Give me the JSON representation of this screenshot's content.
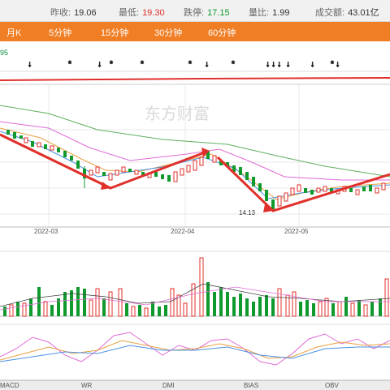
{
  "stats": [
    {
      "label": "昨收:",
      "value": "19.06",
      "color": "#333333"
    },
    {
      "label": "最低:",
      "value": "19.30",
      "color": "#e0302b"
    },
    {
      "label": "跌停:",
      "value": "17.15",
      "color": "#109a2e"
    },
    {
      "label": "量比:",
      "value": "1.99",
      "color": "#333333"
    },
    {
      "label": "成交额:",
      "value": "43.01亿",
      "color": "#333333"
    }
  ],
  "tabs": [
    "月K",
    "5分钟",
    "15分钟",
    "30分钟",
    "60分钟"
  ],
  "side_value": "95",
  "watermark": "东方财富",
  "price_label": "14.13",
  "x_dates": [
    "2022-03",
    "2022-04",
    "2022-05"
  ],
  "bottom_indicators": [
    "MACD",
    "WR",
    "DMI",
    "BIAS",
    "OBV"
  ],
  "colors": {
    "accent": "#f07e25",
    "up": "#e0302b",
    "down": "#109a2e"
  }
}
